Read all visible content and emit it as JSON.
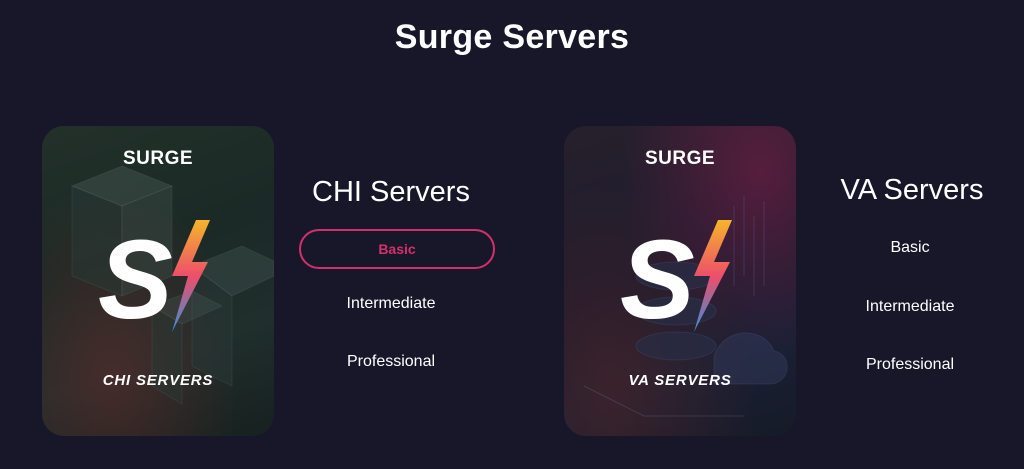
{
  "page": {
    "title": "Surge Servers"
  },
  "cards": {
    "chi": {
      "brand": "SURGE",
      "caption": "CHI SERVERS"
    },
    "va": {
      "brand": "SURGE",
      "caption": "VA SERVERS"
    }
  },
  "plans": {
    "chi": {
      "heading": "CHI Servers",
      "options": [
        "Basic",
        "Intermediate",
        "Professional"
      ],
      "selected": "Basic"
    },
    "va": {
      "heading": "VA Servers",
      "options": [
        "Basic",
        "Intermediate",
        "Professional"
      ],
      "selected": ""
    }
  },
  "colors": {
    "background": "#18172a",
    "accent": "#d2306a",
    "text": "#ffffff"
  },
  "icons": {
    "logo": "surge-lightning-logo-icon"
  }
}
